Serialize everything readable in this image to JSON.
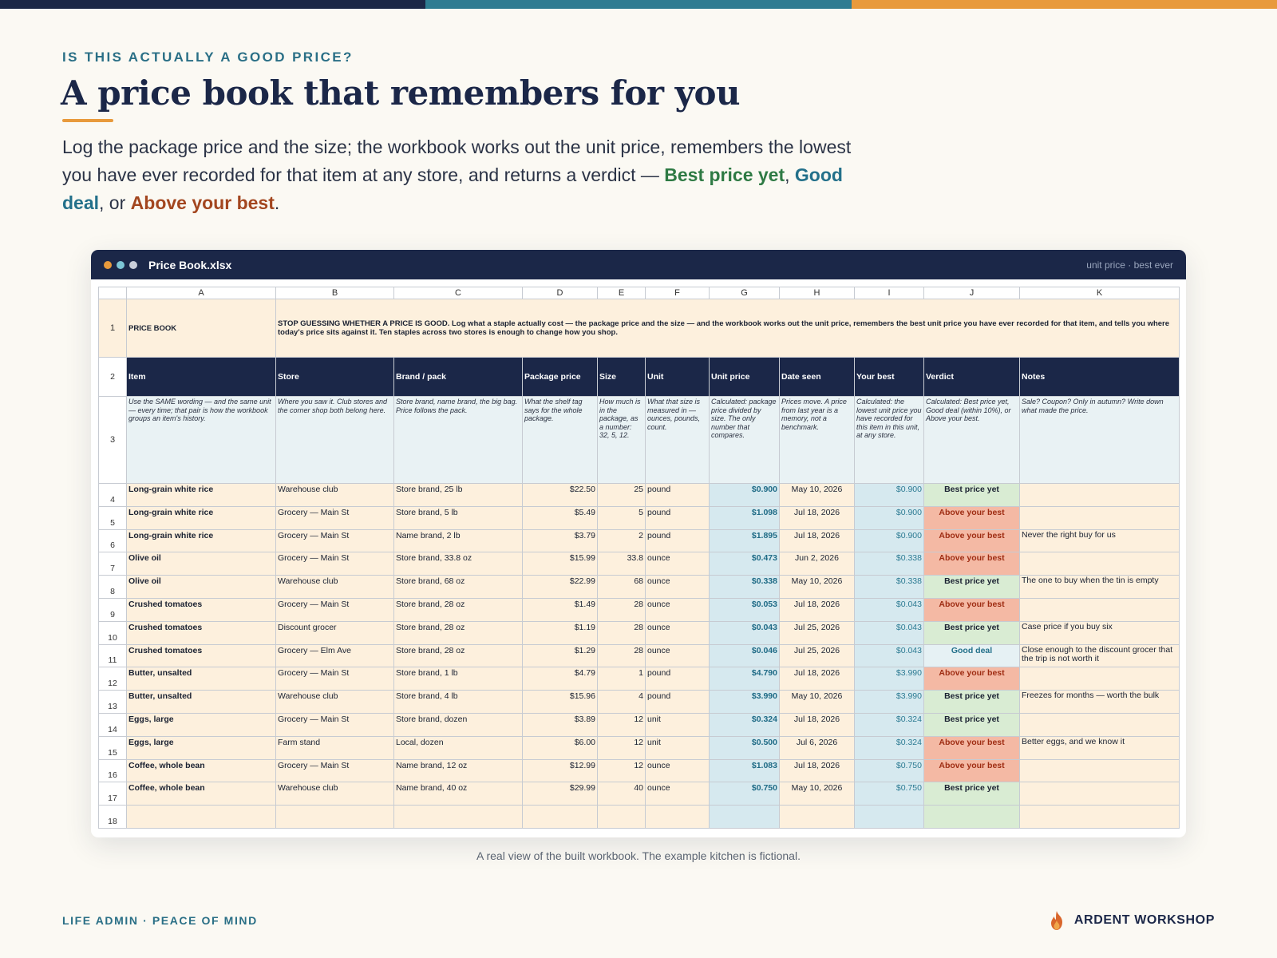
{
  "page": {
    "eyebrow": "IS THIS ACTUALLY A GOOD PRICE?",
    "title": "A price book that remembers for you",
    "lede": {
      "p1": "Log the package price and the size; the workbook works out the unit price, remembers the lowest you have ever recorded for that item at any store, and returns a verdict — ",
      "best": "Best price yet",
      "sep1": ", ",
      "good": "Good deal",
      "sep2": ", or ",
      "above": "Above your best",
      "end": "."
    },
    "caption": "A real view of the built workbook. The example kitchen is fictional.",
    "footer_left": "LIFE ADMIN · PEACE OF MIND",
    "brand": "ARDENT WORKSHOP",
    "brand_icon": "flame-icon"
  },
  "window": {
    "filename": "Price Book.xlsx",
    "tagline": "unit price · best ever"
  },
  "sheet": {
    "columns": [
      "A",
      "B",
      "C",
      "D",
      "E",
      "F",
      "G",
      "H",
      "I",
      "J",
      "K"
    ],
    "row1": {
      "title": "PRICE BOOK",
      "description": "STOP GUESSING WHETHER A PRICE IS GOOD. Log what a staple actually cost — the package price and the size — and the workbook works out the unit price, remembers the best unit price you have ever recorded for that item, and tells you where today's price sits against it. Ten staples across two stores is enough to change how you shop."
    },
    "headers": [
      "Item",
      "Store",
      "Brand / pack",
      "Package price",
      "Size",
      "Unit",
      "Unit price",
      "Date seen",
      "Your best",
      "Verdict",
      "Notes"
    ],
    "hints": [
      "Use the SAME wording — and the same unit — every time; that pair is how the workbook groups an item's history.",
      "Where you saw it. Club stores and the corner shop both belong here.",
      "Store brand, name brand, the big bag. Price follows the pack.",
      "What the shelf tag says for the whole package.",
      "How much is in the package, as a number: 32, 5, 12.",
      "What that size is measured in — ounces, pounds, count.",
      "Calculated: package price divided by size. The only number that compares.",
      "Prices move. A price from last year is a memory, not a benchmark.",
      "Calculated: the lowest unit price you have recorded for this item in this unit, at any store.",
      "Calculated: Best price yet, Good deal (within 10%), or Above your best.",
      "Sale? Coupon? Only in autumn? Write down what made the price."
    ],
    "rows": [
      {
        "n": "4",
        "item": "Long-grain white rice",
        "store": "Warehouse club",
        "brand": "Store brand, 25 lb",
        "price": "$22.50",
        "size": "25",
        "unit": "pound",
        "unit_price": "$0.900",
        "date": "May 10, 2026",
        "best": "$0.900",
        "verdict": "Best price yet",
        "vclass": "best",
        "note": ""
      },
      {
        "n": "5",
        "item": "Long-grain white rice",
        "store": "Grocery — Main St",
        "brand": "Store brand, 5 lb",
        "price": "$5.49",
        "size": "5",
        "unit": "pound",
        "unit_price": "$1.098",
        "date": "Jul 18, 2026",
        "best": "$0.900",
        "verdict": "Above your best",
        "vclass": "above",
        "note": ""
      },
      {
        "n": "6",
        "item": "Long-grain white rice",
        "store": "Grocery — Main St",
        "brand": "Name brand, 2 lb",
        "price": "$3.79",
        "size": "2",
        "unit": "pound",
        "unit_price": "$1.895",
        "date": "Jul 18, 2026",
        "best": "$0.900",
        "verdict": "Above your best",
        "vclass": "above",
        "note": "Never the right buy for us"
      },
      {
        "n": "7",
        "item": "Olive oil",
        "store": "Grocery — Main St",
        "brand": "Store brand, 33.8 oz",
        "price": "$15.99",
        "size": "33.8",
        "unit": "ounce",
        "unit_price": "$0.473",
        "date": "Jun 2, 2026",
        "best": "$0.338",
        "verdict": "Above your best",
        "vclass": "above",
        "note": ""
      },
      {
        "n": "8",
        "item": "Olive oil",
        "store": "Warehouse club",
        "brand": "Store brand, 68 oz",
        "price": "$22.99",
        "size": "68",
        "unit": "ounce",
        "unit_price": "$0.338",
        "date": "May 10, 2026",
        "best": "$0.338",
        "verdict": "Best price yet",
        "vclass": "best",
        "note": "The one to buy when the tin is empty"
      },
      {
        "n": "9",
        "item": "Crushed tomatoes",
        "store": "Grocery — Main St",
        "brand": "Store brand, 28 oz",
        "price": "$1.49",
        "size": "28",
        "unit": "ounce",
        "unit_price": "$0.053",
        "date": "Jul 18, 2026",
        "best": "$0.043",
        "verdict": "Above your best",
        "vclass": "above",
        "note": ""
      },
      {
        "n": "10",
        "item": "Crushed tomatoes",
        "store": "Discount grocer",
        "brand": "Store brand, 28 oz",
        "price": "$1.19",
        "size": "28",
        "unit": "ounce",
        "unit_price": "$0.043",
        "date": "Jul 25, 2026",
        "best": "$0.043",
        "verdict": "Best price yet",
        "vclass": "best",
        "note": "Case price if you buy six"
      },
      {
        "n": "11",
        "item": "Crushed tomatoes",
        "store": "Grocery — Elm Ave",
        "brand": "Store brand, 28 oz",
        "price": "$1.29",
        "size": "28",
        "unit": "ounce",
        "unit_price": "$0.046",
        "date": "Jul 25, 2026",
        "best": "$0.043",
        "verdict": "Good deal",
        "vclass": "good",
        "note": "Close enough to the discount grocer that the trip is not worth it"
      },
      {
        "n": "12",
        "item": "Butter, unsalted",
        "store": "Grocery — Main St",
        "brand": "Store brand, 1 lb",
        "price": "$4.79",
        "size": "1",
        "unit": "pound",
        "unit_price": "$4.790",
        "date": "Jul 18, 2026",
        "best": "$3.990",
        "verdict": "Above your best",
        "vclass": "above",
        "note": ""
      },
      {
        "n": "13",
        "item": "Butter, unsalted",
        "store": "Warehouse club",
        "brand": "Store brand, 4 lb",
        "price": "$15.96",
        "size": "4",
        "unit": "pound",
        "unit_price": "$3.990",
        "date": "May 10, 2026",
        "best": "$3.990",
        "verdict": "Best price yet",
        "vclass": "best",
        "note": "Freezes for months — worth the bulk"
      },
      {
        "n": "14",
        "item": "Eggs, large",
        "store": "Grocery — Main St",
        "brand": "Store brand, dozen",
        "price": "$3.89",
        "size": "12",
        "unit": "unit",
        "unit_price": "$0.324",
        "date": "Jul 18, 2026",
        "best": "$0.324",
        "verdict": "Best price yet",
        "vclass": "best",
        "note": ""
      },
      {
        "n": "15",
        "item": "Eggs, large",
        "store": "Farm stand",
        "brand": "Local, dozen",
        "price": "$6.00",
        "size": "12",
        "unit": "unit",
        "unit_price": "$0.500",
        "date": "Jul 6, 2026",
        "best": "$0.324",
        "verdict": "Above your best",
        "vclass": "above",
        "note": "Better eggs, and we know it"
      },
      {
        "n": "16",
        "item": "Coffee, whole bean",
        "store": "Grocery — Main St",
        "brand": "Name brand, 12 oz",
        "price": "$12.99",
        "size": "12",
        "unit": "ounce",
        "unit_price": "$1.083",
        "date": "Jul 18, 2026",
        "best": "$0.750",
        "verdict": "Above your best",
        "vclass": "above",
        "note": ""
      },
      {
        "n": "17",
        "item": "Coffee, whole bean",
        "store": "Warehouse club",
        "brand": "Name brand, 40 oz",
        "price": "$29.99",
        "size": "40",
        "unit": "ounce",
        "unit_price": "$0.750",
        "date": "May 10, 2026",
        "best": "$0.750",
        "verdict": "Best price yet",
        "vclass": "best",
        "note": ""
      },
      {
        "n": "18",
        "item": "",
        "store": "",
        "brand": "",
        "price": "",
        "size": "",
        "unit": "",
        "unit_price": "",
        "date": "",
        "best": "",
        "verdict": "",
        "vclass": "empty",
        "note": ""
      }
    ]
  },
  "colors": {
    "navy": "#1b2748",
    "teal": "#2e7c92",
    "orange": "#e89a3c",
    "best_green": "#d9ecd3",
    "above_red": "#f4b9a4",
    "peach_row": "#fdf0dd"
  }
}
